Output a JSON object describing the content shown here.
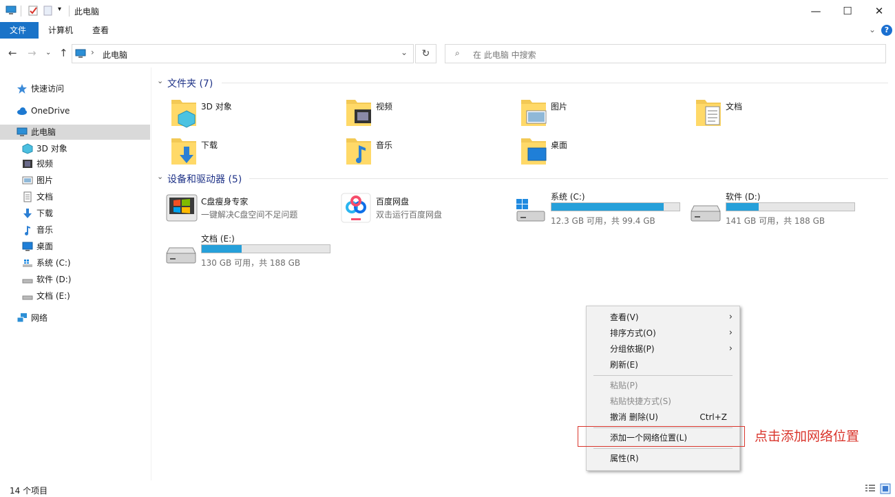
{
  "window": {
    "title": "此电脑",
    "controls": [
      "minimize",
      "maximize",
      "close"
    ]
  },
  "ribbon": {
    "tabs": [
      {
        "label": "文件",
        "active": true
      },
      {
        "label": "计算机",
        "active": false
      },
      {
        "label": "查看",
        "active": false
      }
    ],
    "help": "?"
  },
  "nav": {
    "address": "此电脑",
    "search_placeholder": "在 此电脑 中搜索"
  },
  "sidebar": {
    "items": [
      {
        "label": "快速访问",
        "icon": "star-icon"
      },
      {
        "label": "OneDrive",
        "icon": "cloud-icon"
      },
      {
        "label": "此电脑",
        "icon": "computer-icon",
        "selected": true
      },
      {
        "label": "3D 对象",
        "icon": "cube-icon"
      },
      {
        "label": "视频",
        "icon": "video-icon"
      },
      {
        "label": "图片",
        "icon": "picture-icon"
      },
      {
        "label": "文档",
        "icon": "document-icon"
      },
      {
        "label": "下载",
        "icon": "download-icon"
      },
      {
        "label": "音乐",
        "icon": "music-icon"
      },
      {
        "label": "桌面",
        "icon": "desktop-icon"
      },
      {
        "label": "系统 (C:)",
        "icon": "drive-icon"
      },
      {
        "label": "软件 (D:)",
        "icon": "drive-icon"
      },
      {
        "label": "文档 (E:)",
        "icon": "drive-icon"
      },
      {
        "label": "网络",
        "icon": "network-icon"
      }
    ]
  },
  "folders_group": {
    "title": "文件夹 (7)",
    "items": [
      {
        "label": "3D 对象",
        "icon": "cube-folder-icon"
      },
      {
        "label": "视频",
        "icon": "video-folder-icon"
      },
      {
        "label": "图片",
        "icon": "picture-folder-icon"
      },
      {
        "label": "文档",
        "icon": "document-folder-icon"
      },
      {
        "label": "下载",
        "icon": "download-folder-icon"
      },
      {
        "label": "音乐",
        "icon": "music-folder-icon"
      },
      {
        "label": "桌面",
        "icon": "desktop-folder-icon"
      }
    ]
  },
  "devices_group": {
    "title": "设备和驱动器 (5)",
    "apps": [
      {
        "title": "C盘瘦身专家",
        "subtitle": "一键解决C盘空间不足问题",
        "icon": "cleaner-app-icon"
      },
      {
        "title": "百度网盘",
        "subtitle": "双击运行百度网盘",
        "icon": "baidu-netdisk-icon"
      }
    ],
    "drives": [
      {
        "title": "系统 (C:)",
        "info": "12.3 GB 可用，共 99.4 GB",
        "used_fraction": 0.876,
        "icon": "windows-drive-icon"
      },
      {
        "title": "软件 (D:)",
        "info": "141 GB 可用，共 188 GB",
        "used_fraction": 0.25,
        "icon": "drive-icon"
      },
      {
        "title": "文档 (E:)",
        "info": "130 GB 可用，共 188 GB",
        "used_fraction": 0.31,
        "icon": "drive-icon"
      }
    ]
  },
  "context_menu": {
    "items": [
      {
        "label": "查看(V)",
        "submenu": true
      },
      {
        "label": "排序方式(O)",
        "submenu": true
      },
      {
        "label": "分组依据(P)",
        "submenu": true
      },
      {
        "label": "刷新(E)"
      },
      {
        "label": "粘贴(P)",
        "disabled": true
      },
      {
        "label": "粘贴快捷方式(S)",
        "disabled": true
      },
      {
        "label": "撤消 删除(U)",
        "shortcut": "Ctrl+Z"
      },
      {
        "label": "添加一个网络位置(L)",
        "highlighted": true
      },
      {
        "label": "属性(R)"
      }
    ]
  },
  "annotation": {
    "text": "点击添加网络位置",
    "color": "#d9342b"
  },
  "status": {
    "text": "14 个项目"
  },
  "colors": {
    "accent": "#1a73c8",
    "group_header": "#1e3287",
    "drive_bar": "#26a0da"
  }
}
